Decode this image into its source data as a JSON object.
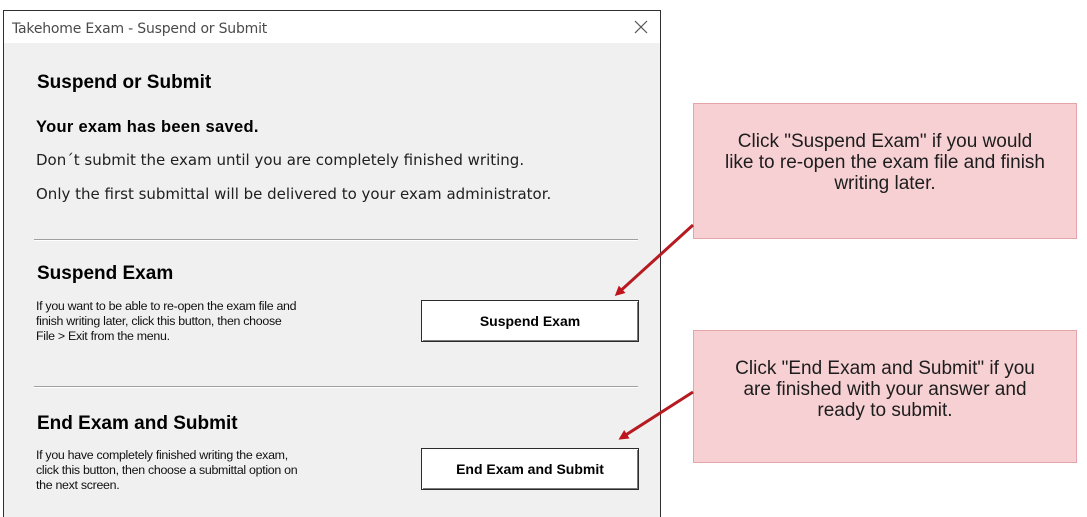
{
  "window": {
    "title": "Takehome Exam - Suspend or Submit"
  },
  "dialog": {
    "heading": "Suspend or Submit",
    "saved_message": "Your exam has been saved.",
    "line1": "Don´t submit the exam until you are completely finished writing.",
    "line2": "Only the first submittal will be delivered to your exam administrator."
  },
  "suspend": {
    "title": "Suspend Exam",
    "description_lines": [
      "If you want to be able to re-open the exam file and",
      "finish writing later, click this button, then choose",
      "File > Exit from the menu."
    ],
    "button_label": "Suspend Exam"
  },
  "submit": {
    "title": "End Exam and Submit",
    "description_lines": [
      "If you have completely finished writing the exam,",
      "click this button, then choose a submittal option on",
      "the next screen."
    ],
    "button_label": "End Exam and Submit"
  },
  "callouts": {
    "suspend": {
      "lines": [
        "Click \"Suspend Exam\" if you would",
        "like to re-open the exam file and finish",
        "writing later."
      ]
    },
    "submit": {
      "lines": [
        "Click \"End Exam and Submit\" if you",
        "are finished with your answer and",
        "ready to submit."
      ]
    }
  },
  "icons": {
    "close": "close-icon"
  },
  "colors": {
    "dialog_bg": "#f0f0f0",
    "callout_bg": "#f7d0d3",
    "callout_border": "#e3a4aa",
    "arrow": "#c0141c"
  }
}
